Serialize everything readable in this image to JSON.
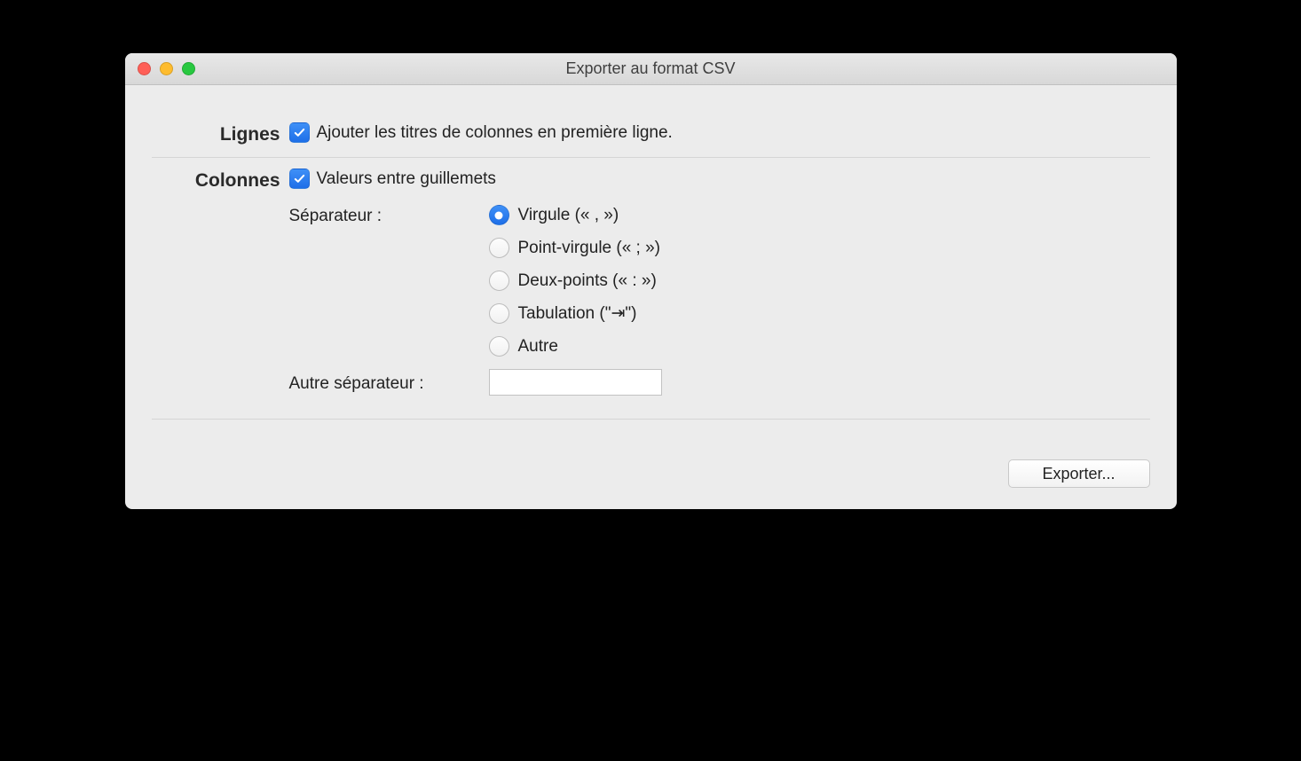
{
  "window": {
    "title": "Exporter au format CSV"
  },
  "sections": {
    "lines_label": "Lignes",
    "columns_label": "Colonnes"
  },
  "lines": {
    "add_headers_label": "Ajouter les titres de colonnes en première ligne."
  },
  "columns": {
    "quote_values_label": "Valeurs entre guillemets",
    "separator_label": "Séparateur :",
    "other_separator_label": "Autre séparateur :",
    "other_separator_value": "",
    "options": {
      "comma": "Virgule (« , »)",
      "semicolon": "Point-virgule (« ; »)",
      "colon": "Deux-points (« : »)",
      "tab": "Tabulation (\"⇥\")",
      "other": "Autre"
    }
  },
  "footer": {
    "export_label": "Exporter..."
  }
}
